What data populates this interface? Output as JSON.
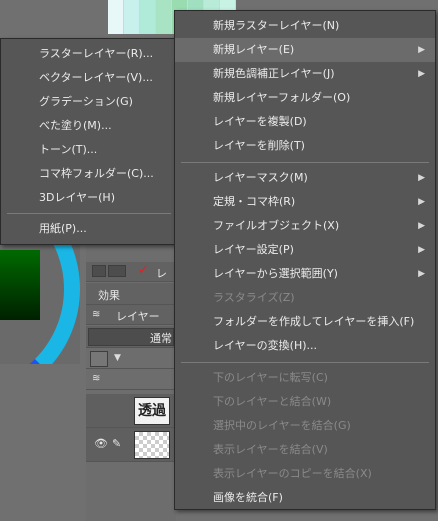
{
  "main_menu": {
    "items": [
      {
        "label": "新規ラスターレイヤー(N)",
        "submenu": false,
        "enabled": true
      },
      {
        "label": "新規レイヤー(E)",
        "submenu": true,
        "enabled": true,
        "highlighted": true
      },
      {
        "label": "新規色調補正レイヤー(J)",
        "submenu": true,
        "enabled": true
      },
      {
        "label": "新規レイヤーフォルダー(O)",
        "submenu": false,
        "enabled": true
      },
      {
        "label": "レイヤーを複製(D)",
        "submenu": false,
        "enabled": true
      },
      {
        "label": "レイヤーを削除(T)",
        "submenu": false,
        "enabled": true
      },
      {
        "label": "レイヤーマスク(M)",
        "submenu": true,
        "enabled": true
      },
      {
        "label": "定規・コマ枠(R)",
        "submenu": true,
        "enabled": true
      },
      {
        "label": "ファイルオブジェクト(X)",
        "submenu": true,
        "enabled": true
      },
      {
        "label": "レイヤー設定(P)",
        "submenu": true,
        "enabled": true
      },
      {
        "label": "レイヤーから選択範囲(Y)",
        "submenu": true,
        "enabled": true
      },
      {
        "label": "ラスタライズ(Z)",
        "submenu": false,
        "enabled": false
      },
      {
        "label": "フォルダーを作成してレイヤーを挿入(F)",
        "submenu": false,
        "enabled": true
      },
      {
        "label": "レイヤーの変換(H)...",
        "submenu": false,
        "enabled": true
      },
      {
        "label": "下のレイヤーに転写(C)",
        "submenu": false,
        "enabled": false
      },
      {
        "label": "下のレイヤーと結合(W)",
        "submenu": false,
        "enabled": false
      },
      {
        "label": "選択中のレイヤーを結合(G)",
        "submenu": false,
        "enabled": false
      },
      {
        "label": "表示レイヤーを結合(V)",
        "submenu": false,
        "enabled": false
      },
      {
        "label": "表示レイヤーのコピーを結合(X)",
        "submenu": false,
        "enabled": false
      },
      {
        "label": "画像を統合(F)",
        "submenu": false,
        "enabled": true
      }
    ]
  },
  "sub_menu": {
    "items": [
      {
        "label": "ラスターレイヤー(R)..."
      },
      {
        "label": "ベクターレイヤー(V)..."
      },
      {
        "label": "グラデーション(G)"
      },
      {
        "label": "べた塗り(M)..."
      },
      {
        "label": "トーン(T)..."
      },
      {
        "label": "コマ枠フォルダー(C)..."
      },
      {
        "label": "3Dレイヤー(H)"
      },
      {
        "label": "用紙(P)..."
      }
    ]
  },
  "background": {
    "tool_label": "レイ",
    "effect_label": "効果",
    "layer_tab_label": "レイヤー",
    "blend_mode": "通常",
    "layer_thumb_text": "透過"
  },
  "colors": {
    "menu_bg": "#565656",
    "highlight": "#6b6b6b",
    "disabled_text": "#8a8a8a",
    "wheel": "#1ab6e6"
  }
}
